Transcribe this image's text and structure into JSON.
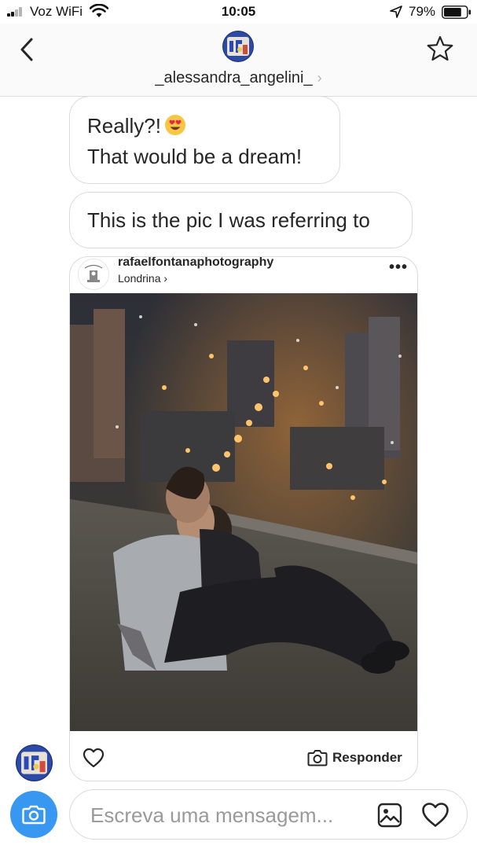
{
  "status_bar": {
    "carrier": "Voz WiFi",
    "time": "10:05",
    "battery_percent": "79%",
    "battery_level": 0.79,
    "icons": [
      "signal-icon",
      "wifi-icon",
      "location-arrow-icon",
      "battery-icon"
    ]
  },
  "header": {
    "username": "_alessandra_angelini_",
    "chevron": "›",
    "icons": [
      "back-chevron-icon",
      "star-icon"
    ]
  },
  "messages": [
    {
      "lines": [
        "Really?!",
        "That would be a dream!"
      ],
      "emoji": "heart-eyes-emoji"
    },
    {
      "text": "This is the pic I was referring to"
    }
  ],
  "shared_post": {
    "username": "rafaelfontanaphotography",
    "location": "Londrina",
    "location_chevron": "›",
    "more": "•••",
    "reply_label": "Responder",
    "icons": [
      "heart-icon",
      "camera-icon",
      "more-icon"
    ]
  },
  "composer": {
    "placeholder": "Escreva uma mensagem...",
    "icons": [
      "camera-icon",
      "gallery-icon",
      "heart-icon"
    ]
  },
  "colors": {
    "accent": "#3897f0",
    "text": "#262626",
    "border": "#dbdbdb",
    "header_bg": "#fafafa"
  }
}
